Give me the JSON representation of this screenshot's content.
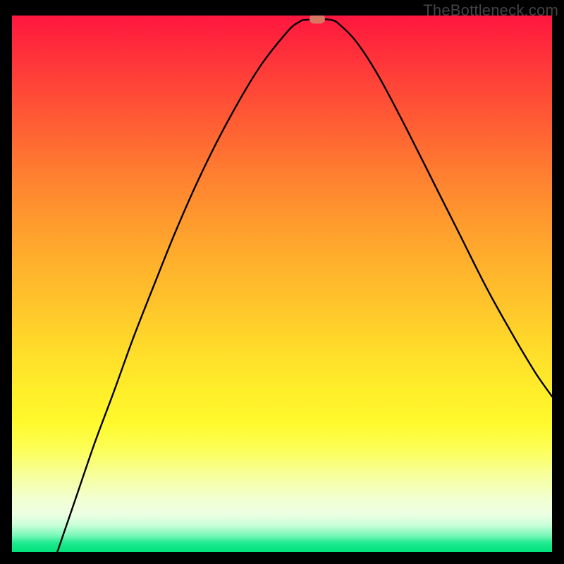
{
  "watermark": "TheBottleneck.com",
  "chart_data": {
    "type": "line",
    "title": "",
    "xlabel": "",
    "ylabel": "",
    "xlim": [
      0,
      1
    ],
    "ylim": [
      0,
      1
    ],
    "marker": {
      "x": 0.565,
      "y": 0.994
    },
    "series": [
      {
        "name": "curve",
        "points": [
          {
            "x": 0.084,
            "y": 0.0
          },
          {
            "x": 0.118,
            "y": 0.1
          },
          {
            "x": 0.152,
            "y": 0.2
          },
          {
            "x": 0.189,
            "y": 0.3
          },
          {
            "x": 0.225,
            "y": 0.4
          },
          {
            "x": 0.264,
            "y": 0.5
          },
          {
            "x": 0.304,
            "y": 0.6
          },
          {
            "x": 0.348,
            "y": 0.7
          },
          {
            "x": 0.398,
            "y": 0.8
          },
          {
            "x": 0.456,
            "y": 0.9
          },
          {
            "x": 0.51,
            "y": 0.97
          },
          {
            "x": 0.532,
            "y": 0.988
          },
          {
            "x": 0.545,
            "y": 0.992
          },
          {
            "x": 0.59,
            "y": 0.992
          },
          {
            "x": 0.61,
            "y": 0.98
          },
          {
            "x": 0.64,
            "y": 0.948
          },
          {
            "x": 0.68,
            "y": 0.885
          },
          {
            "x": 0.73,
            "y": 0.79
          },
          {
            "x": 0.78,
            "y": 0.69
          },
          {
            "x": 0.83,
            "y": 0.59
          },
          {
            "x": 0.88,
            "y": 0.49
          },
          {
            "x": 0.93,
            "y": 0.4
          },
          {
            "x": 0.97,
            "y": 0.333
          },
          {
            "x": 1.0,
            "y": 0.29
          }
        ]
      }
    ],
    "background_gradient": {
      "direction": "vertical",
      "stops": [
        {
          "pos": 0.0,
          "color": "#ff163f"
        },
        {
          "pos": 0.3,
          "color": "#ff8030"
        },
        {
          "pos": 0.62,
          "color": "#ffdb2a"
        },
        {
          "pos": 0.81,
          "color": "#fcff58"
        },
        {
          "pos": 0.93,
          "color": "#ecffe2"
        },
        {
          "pos": 1.0,
          "color": "#00e27b"
        }
      ]
    }
  }
}
